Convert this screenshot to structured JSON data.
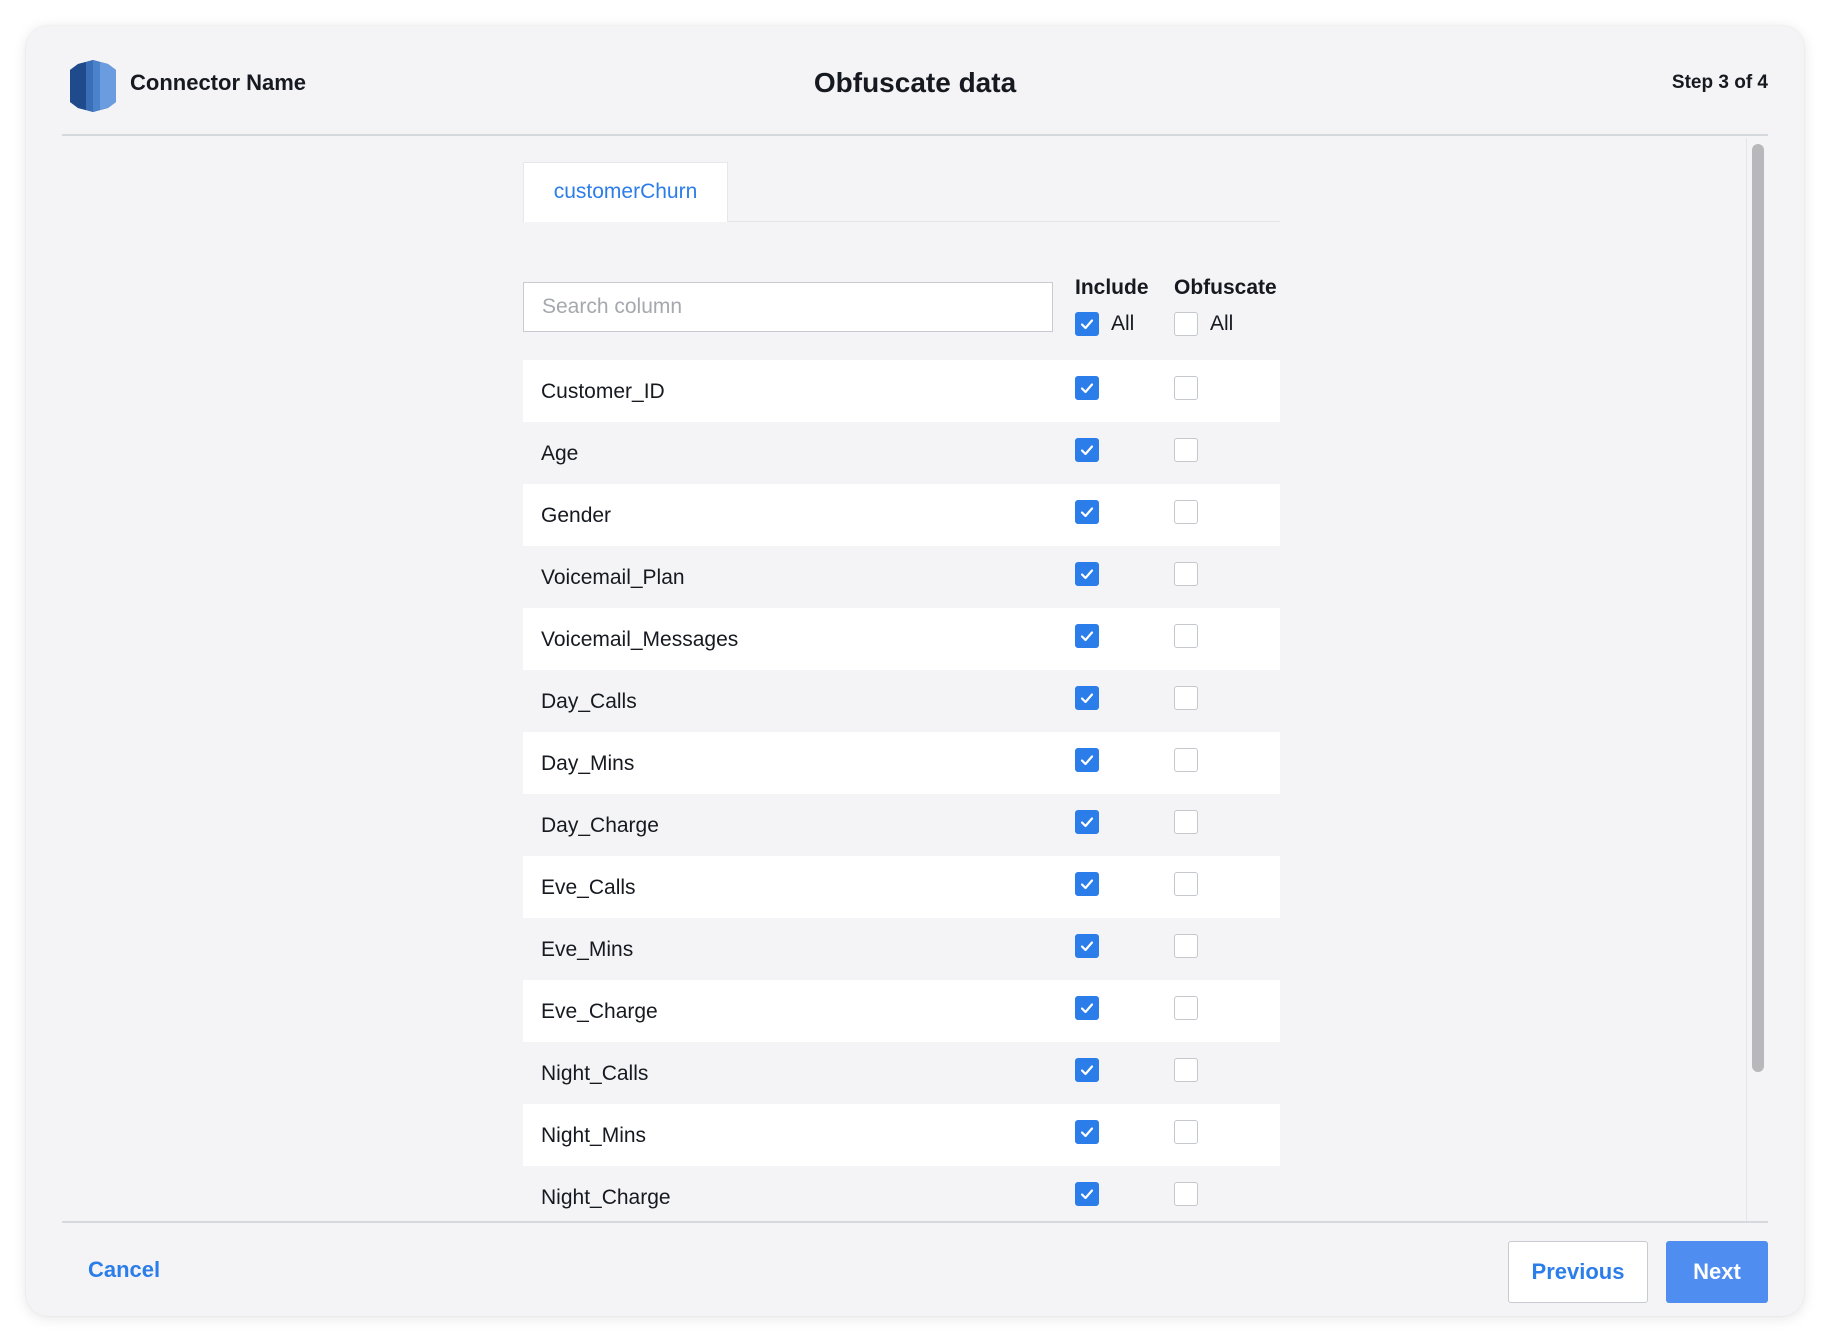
{
  "header": {
    "connector_name": "Connector Name",
    "title": "Obfuscate data",
    "step": "Step 3 of 4"
  },
  "tabs": [
    {
      "label": "customerChurn",
      "active": true
    }
  ],
  "search": {
    "placeholder": "Search column",
    "value": ""
  },
  "columns_header": {
    "include": "Include",
    "obfuscate": "Obfuscate",
    "include_all_label": "All",
    "include_all_checked": true,
    "obfuscate_all_label": "All",
    "obfuscate_all_checked": false
  },
  "rows": [
    {
      "name": "Customer_ID",
      "include": true,
      "obfuscate": false
    },
    {
      "name": "Age",
      "include": true,
      "obfuscate": false
    },
    {
      "name": "Gender",
      "include": true,
      "obfuscate": false
    },
    {
      "name": "Voicemail_Plan",
      "include": true,
      "obfuscate": false
    },
    {
      "name": "Voicemail_Messages",
      "include": true,
      "obfuscate": false
    },
    {
      "name": "Day_Calls",
      "include": true,
      "obfuscate": false
    },
    {
      "name": "Day_Mins",
      "include": true,
      "obfuscate": false
    },
    {
      "name": "Day_Charge",
      "include": true,
      "obfuscate": false
    },
    {
      "name": "Eve_Calls",
      "include": true,
      "obfuscate": false
    },
    {
      "name": "Eve_Mins",
      "include": true,
      "obfuscate": false
    },
    {
      "name": "Eve_Charge",
      "include": true,
      "obfuscate": false
    },
    {
      "name": "Night_Calls",
      "include": true,
      "obfuscate": false
    },
    {
      "name": "Night_Mins",
      "include": true,
      "obfuscate": false
    },
    {
      "name": "Night_Charge",
      "include": true,
      "obfuscate": false
    },
    {
      "name": "",
      "include": true,
      "obfuscate": false
    }
  ],
  "footer": {
    "cancel_label": "Cancel",
    "previous_label": "Previous",
    "next_label": "Next"
  },
  "colors": {
    "accent": "#2b7de9",
    "next_button": "#4f8df0",
    "dialog_background": "#f4f4f6"
  },
  "icons": {
    "logo": "connector-logo-icon",
    "checkbox_checked": "checkmark-icon"
  }
}
